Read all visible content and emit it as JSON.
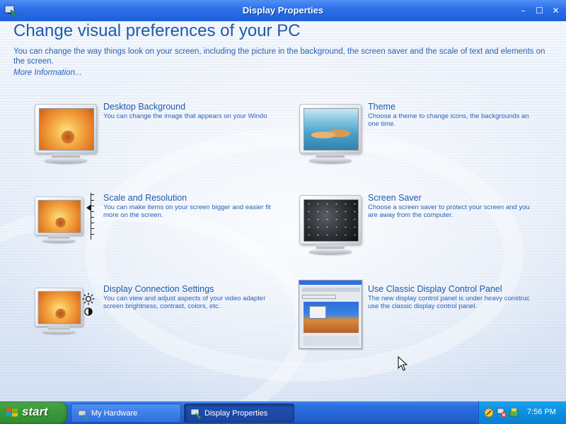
{
  "window": {
    "title": "Display Properties",
    "buttons": {
      "minimize": "–",
      "maximize": "☐",
      "close": "✕"
    }
  },
  "header": {
    "title": "Change visual preferences of your PC",
    "description": "You can change the way things look on your screen, including the picture in the background, the screen saver and the scale of text and elements on the screen.",
    "more_link": "More Information..."
  },
  "items": [
    {
      "title": "Desktop Background",
      "desc": "You can change the image that appears on your Windo",
      "icon": "desktop-background-icon"
    },
    {
      "title": "Theme",
      "desc": "Choose a theme to change icons, the backgrounds an one time.",
      "icon": "theme-icon"
    },
    {
      "title": "Scale and Resolution",
      "desc": "You can make items on your screen bigger and easier fit more on the screen.",
      "icon": "scale-resolution-icon"
    },
    {
      "title": "Screen Saver",
      "desc": "Choose a screen saver to protect your screen and you are away from the computer.",
      "icon": "screen-saver-icon"
    },
    {
      "title": "Display Connection Settings",
      "desc": "You can view and adjust aspects of your video adapter screen brightness, contrast, colors, etc.",
      "icon": "display-connection-icon"
    },
    {
      "title": "Use Classic Display Control Panel",
      "desc": "The new display control panel is under heavy construc use the classic display control panel.",
      "icon": "classic-display-icon"
    }
  ],
  "taskbar": {
    "start_label": "start",
    "tasks": [
      {
        "label": "My Hardware",
        "active": false
      },
      {
        "label": "Display Properties",
        "active": true
      }
    ],
    "clock": "7:56 PM"
  },
  "colors": {
    "titlebar": "#2a6ee8",
    "heading": "#1f5aa8",
    "text": "#2a62b4",
    "start_green": "#3c9a3d",
    "tray_blue": "#0d8ee0"
  }
}
